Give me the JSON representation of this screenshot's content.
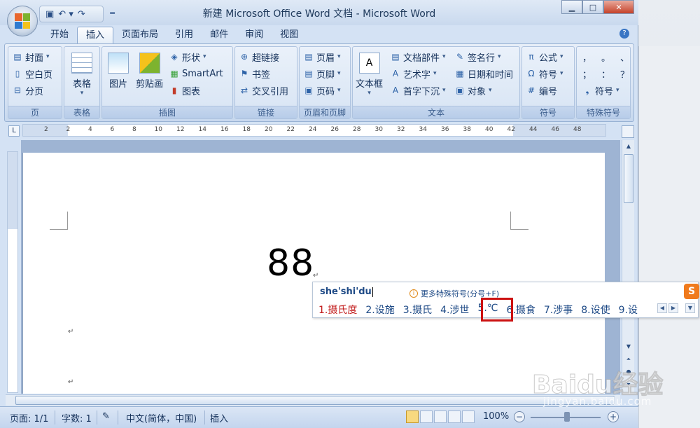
{
  "window": {
    "title": "新建 Microsoft Office Word 文档 - Microsoft Word",
    "minimize": "▁",
    "maximize": "□",
    "close": "✕"
  },
  "quick_access": {
    "save_icon": "floppy-icon",
    "undo_icon": "undo-icon",
    "redo_icon": "redo-icon",
    "more": "="
  },
  "tabs": [
    "开始",
    "插入",
    "页面布局",
    "引用",
    "邮件",
    "审阅",
    "视图"
  ],
  "active_tab": "插入",
  "ribbon": {
    "pages": {
      "label": "页",
      "items": [
        "封面",
        "空白页",
        "分页"
      ]
    },
    "tables": {
      "label": "表格",
      "item": "表格"
    },
    "illustrations": {
      "label": "插图",
      "picture": "图片",
      "clipart": "剪贴画",
      "shapes": "形状",
      "smartart": "SmartArt",
      "chart": "图表"
    },
    "links": {
      "label": "链接",
      "items": [
        "超链接",
        "书签",
        "交叉引用"
      ]
    },
    "header_footer": {
      "label": "页眉和页脚",
      "items": [
        "页眉",
        "页脚",
        "页码"
      ]
    },
    "text": {
      "label": "文本",
      "textbox": "文本框",
      "items_col1": [
        "文档部件",
        "艺术字",
        "首字下沉"
      ],
      "items_col2": [
        "签名行",
        "日期和时间",
        "对象"
      ]
    },
    "symbols": {
      "label": "符号",
      "items": [
        "公式",
        "符号",
        "编号"
      ]
    },
    "special": {
      "label": "特殊符号",
      "row1": [
        "，",
        "。",
        "、"
      ],
      "row2": [
        "；",
        "：",
        "？"
      ],
      "symbol_button": "符号"
    }
  },
  "ruler": {
    "corner": "L",
    "ticks": [
      "2",
      "2",
      "4",
      "6",
      "8",
      "10",
      "12",
      "14",
      "16",
      "18",
      "20",
      "22",
      "24",
      "26",
      "28",
      "30",
      "32",
      "34",
      "36",
      "38",
      "40",
      "42",
      "44",
      "46",
      "48"
    ]
  },
  "document": {
    "text": "88",
    "para_mark": "↵"
  },
  "ime": {
    "input": "she'shi'du",
    "hint": "更多特殊符号(分号+F)",
    "logo": "S",
    "candidates": [
      "1.摄氏度",
      "2.设施",
      "3.摄氏",
      "4.涉世",
      "5.℃",
      "6.摄食",
      "7.涉事",
      "8.设使",
      "9.设"
    ],
    "highlighted": "5.℃"
  },
  "status_bar": {
    "page": "页面: 1/1",
    "words": "字数: 1",
    "language": "中文(简体，中国)",
    "mode": "插入",
    "zoom": "100%"
  },
  "watermark": {
    "brand": "Baidu经验",
    "url": "jingyan.baidu.com"
  }
}
